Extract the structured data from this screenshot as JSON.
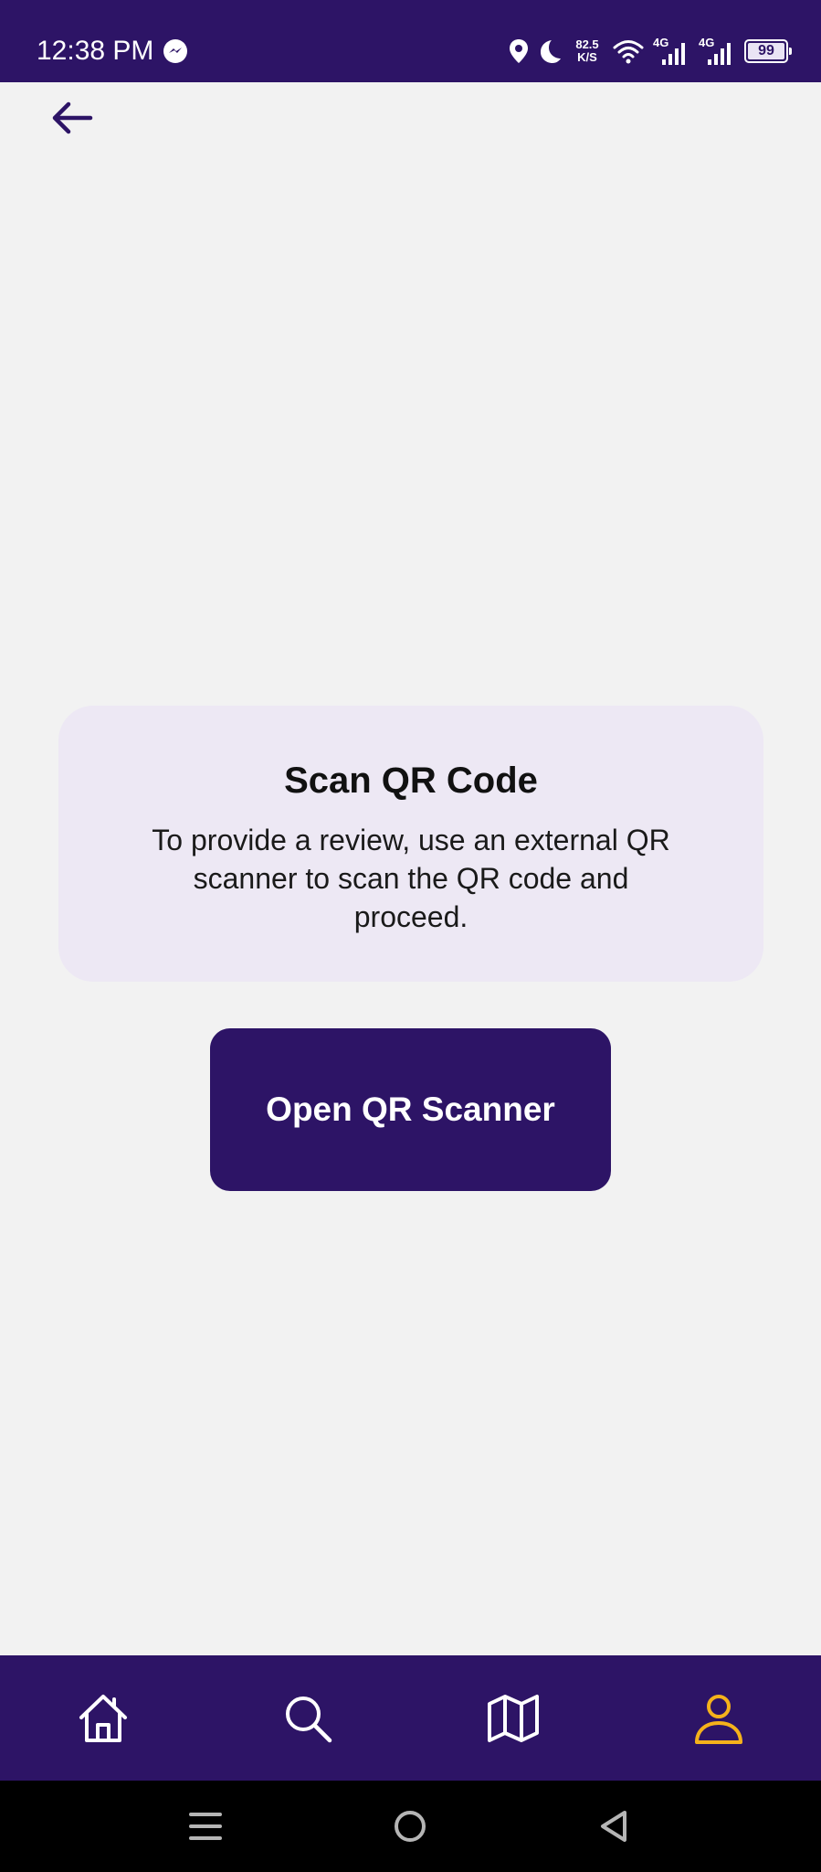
{
  "status_bar": {
    "time": "12:38 PM",
    "net_speed_value": "82.5",
    "net_speed_unit": "K/S",
    "sim1_label": "4G",
    "sim2_label": "4G",
    "battery_level": "99",
    "battery_fraction": 0.99
  },
  "icons": {
    "back": "arrow-left-icon",
    "messenger": "messenger-icon",
    "location": "location-pin-icon",
    "do_not_disturb": "moon-icon",
    "wifi": "wifi-icon",
    "signal": "signal-bars-icon",
    "battery": "battery-icon",
    "nav_home": "home-icon",
    "nav_search": "search-icon",
    "nav_map": "map-icon",
    "nav_profile": "user-icon",
    "sys_recents": "menu-lines-icon",
    "sys_home": "circle-home-icon",
    "sys_back": "triangle-back-icon"
  },
  "card": {
    "title": "Scan QR Code",
    "description": "To provide a review, use an external QR scanner to scan the QR code and proceed."
  },
  "primary_button": {
    "label": "Open QR Scanner"
  },
  "colors": {
    "brand": "#2d1466",
    "background": "#f2f2f2",
    "card_bg": "#ede8f4",
    "active_nav": "#f5b21b",
    "inactive_nav": "#ffffff"
  }
}
